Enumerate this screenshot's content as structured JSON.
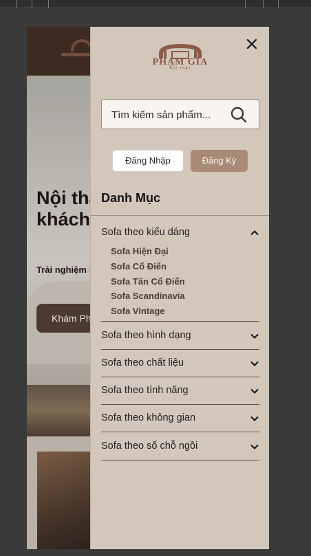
{
  "background_page": {
    "hero_title": "Nội thất cho phòng khách hiện đại",
    "hero_subtitle": "Trải nghiệm sang trọng cùng",
    "hero_cta": "Khám Phá"
  },
  "drawer": {
    "logo": {
      "brand": "PHẠM GIA",
      "tagline": "NỘI THẤT"
    },
    "search": {
      "placeholder": "Tìm kiếm sản phẩm..."
    },
    "login_label": "Đăng Nhập",
    "register_label": "Đăng Ký",
    "category_heading": "Danh Mục",
    "categories": [
      {
        "label": "Sofa theo kiểu dáng",
        "expanded": true,
        "children": [
          "Sofa Hiện Đại",
          "Sofa Cổ Điển",
          "Sofa Tân Cổ Điển",
          "Sofa Scandinavia",
          "Sofa Vintage"
        ]
      },
      {
        "label": "Sofa theo hình dạng",
        "expanded": false
      },
      {
        "label": "Sofa theo chất liệu",
        "expanded": false
      },
      {
        "label": "Sofa theo tính năng",
        "expanded": false
      },
      {
        "label": "Sofa theo không gian",
        "expanded": false
      },
      {
        "label": "Sofa theo số chỗ ngồi",
        "expanded": false
      }
    ]
  },
  "colors": {
    "drawer_bg": "#d3c7bc",
    "brand": "#8b5a48",
    "register_btn": "#a88a77",
    "header_dark": "#3d2b22"
  },
  "icons": {
    "close": "close-icon",
    "search": "search-icon",
    "chevron_up": "chevron-up-icon",
    "chevron_down": "chevron-down-icon"
  }
}
